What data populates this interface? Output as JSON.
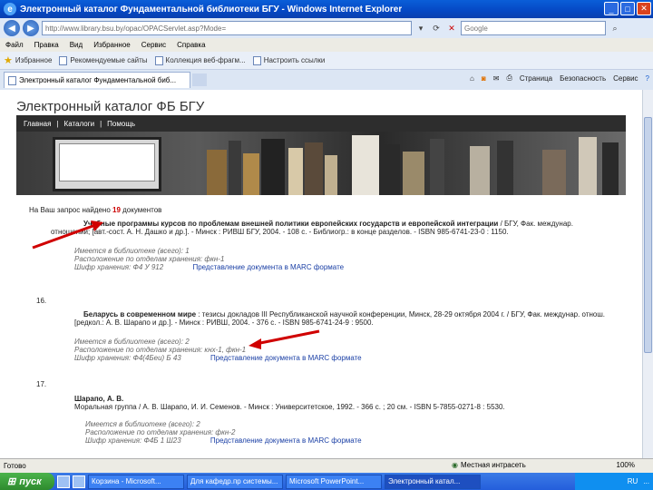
{
  "window": {
    "title": "Электронный каталог Фундаментальной библиотеки БГУ - Windows Internet Explorer",
    "logo": "e"
  },
  "address": {
    "url": "http://www.library.bsu.by/opac/OPACServlet.asp?Mode=",
    "search_placeholder": "Google"
  },
  "menu": [
    "Файл",
    "Правка",
    "Вид",
    "Избранное",
    "Сервис",
    "Справка"
  ],
  "favorites": {
    "label": "Избранное",
    "items": [
      "Рекомендуемые сайты",
      "Коллекция веб-фрагм...",
      "Настроить ссылки"
    ]
  },
  "tab": {
    "label": "Электронный каталог Фундаментальной биб...",
    "commands": [
      "Страница",
      "Безопасность",
      "Сервис"
    ]
  },
  "page": {
    "catalog_title": "Электронный каталог ФБ БГУ",
    "nav": [
      "Главная",
      "|",
      "Каталоги",
      "|",
      "Помощь"
    ],
    "results_prefix": "На Ваш запрос найдено",
    "results_count": "19",
    "results_suffix": "документов",
    "records": [
      {
        "line1": "Учебные программы курсов по проблемам внешней политики европейских государств и европейской интеграции",
        "line1_tail": "/ БГУ, Фак. междунар.",
        "line2": "отношений; [авт.-сост. А. Н. Дашко и др.]. - Минск : РИВШ БГУ, 2004. - 108 с. - Библиогр.: в конце разделов. - ISBN 985-6741-23-0 : 1150.",
        "copies": "Имеется в библиотеке (всего): 1",
        "location": "Расположение по отделам хранения: фкн-1",
        "shelf": "Шифр хранения: Ф4 У 912",
        "marc_link": "Представление документа в MARC формате"
      },
      {
        "number": "16.",
        "line1": "Беларусь в современном мире",
        "line1_tail": ": тезисы докладов III Республиканской научной конференции, Минск, 28-29 октября 2004 г. / БГУ, Фак. междунар. отнош.",
        "line2": "[редкол.: А. В. Шарапо и др.]. - Минск : РИВШ, 2004. - 376 с. - ISBN 985-6741-24-9 : 9500.",
        "copies": "Имеется в библиотеке (всего): 2",
        "location": "Расположение по отделам хранения: кнх-1, фкн-1",
        "shelf": "Шифр хранения: Ф4(4Беи) Б 43",
        "marc_link": "Представление документа в MARC формате"
      },
      {
        "number": "17.",
        "line1": "Шарапо, А. В.",
        "line2": "Моральная группа / А. В. Шарапо, И. И. Семенов. - Минск : Университетское, 1992. - 366 с. ; 20 см. - ISBN 5-7855-0271-8 : 5530.",
        "copies": "Имеется в библиотеке (всего): 2",
        "location": "Расположение по отделам хранения: фкн-2",
        "shelf": "Шифр хранения: Ф4Б 1 Ш23",
        "marc_link": "Представление документа в MARC формате"
      }
    ]
  },
  "status": {
    "left": "Готово",
    "zone": "Местная интрасеть",
    "zoom": "100%"
  },
  "taskbar": {
    "start": "пуск",
    "buttons": [
      "Корзина - Microsoft...",
      "Для кафедр.пр системы...",
      "Microsoft PowerPoint...",
      "Электронный катал..."
    ],
    "lang": "RU",
    "clock": "..."
  },
  "colors": {
    "accent_red": "#c00000",
    "link_blue": "#1a3fa5",
    "titlebar_blue": "#0548c4"
  }
}
